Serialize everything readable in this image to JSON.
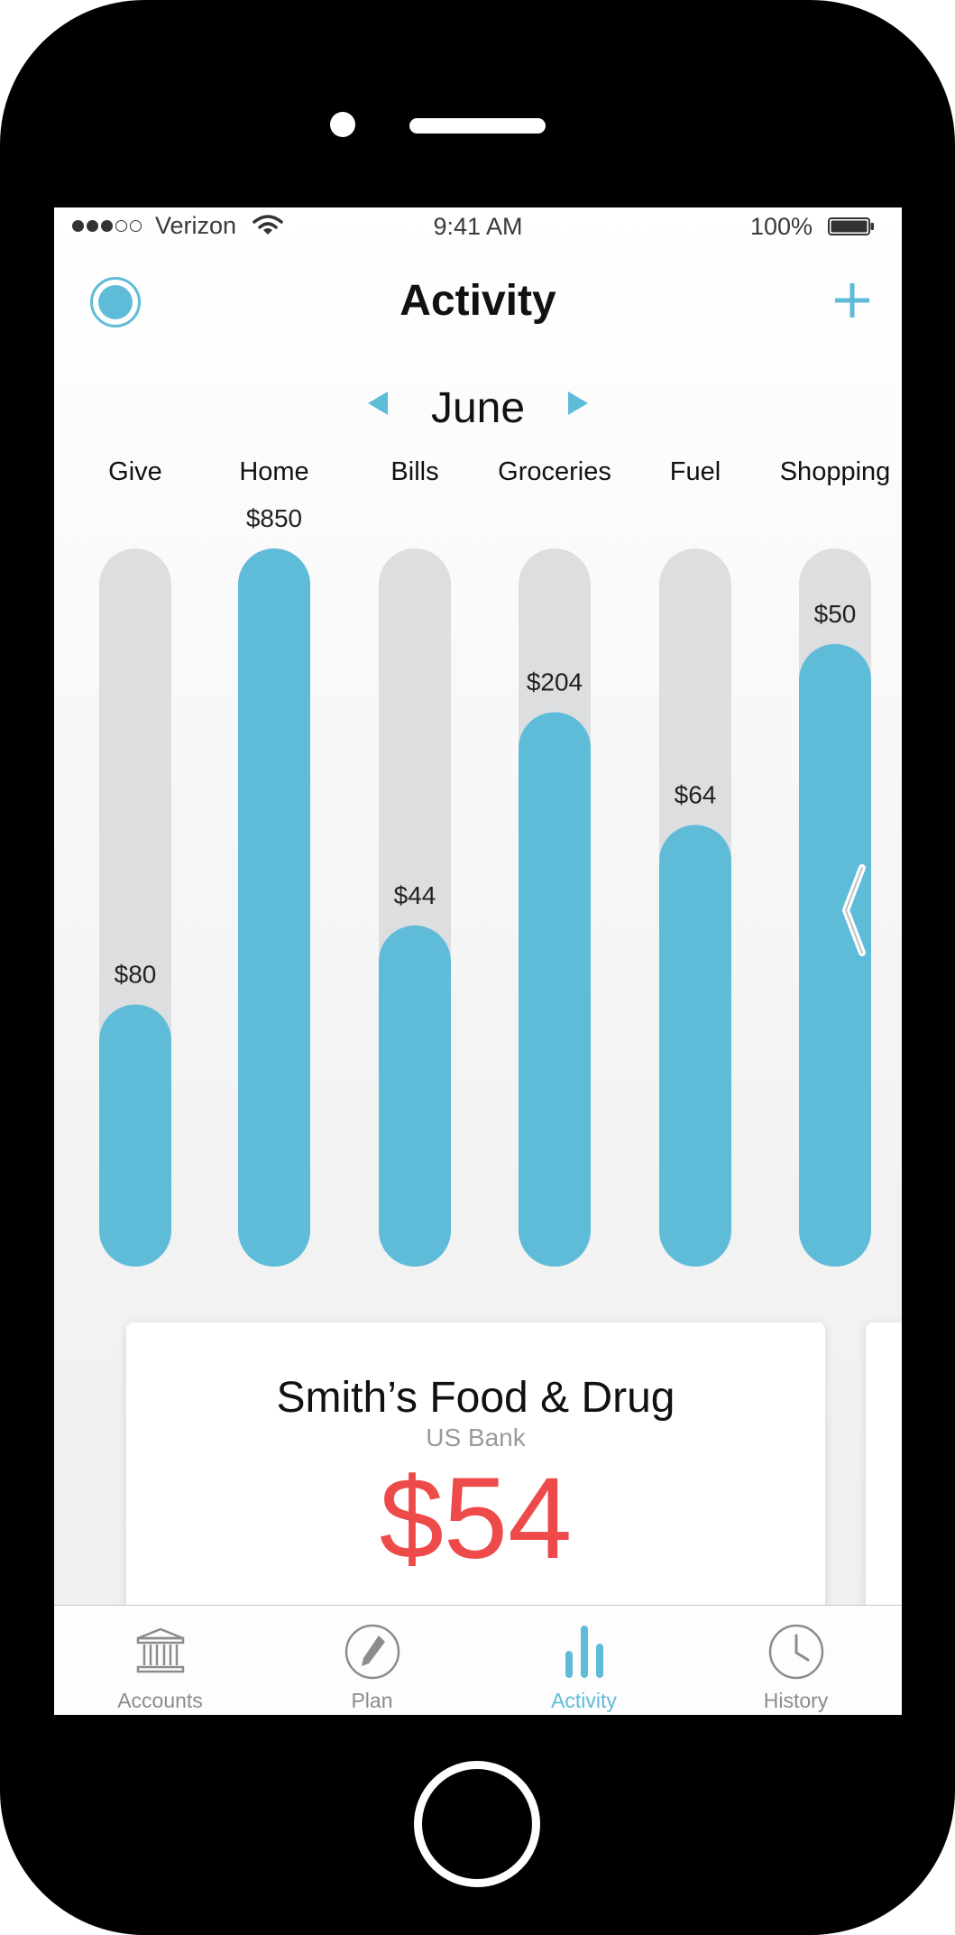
{
  "status_bar": {
    "carrier": "Verizon",
    "time": "9:41 AM",
    "battery": "100%",
    "signal_bars_filled": 3,
    "signal_bars_total": 5
  },
  "header": {
    "title": "Activity",
    "profile_icon": "profile-circle-icon",
    "add_icon": "plus-icon"
  },
  "month_selector": {
    "month": "June",
    "prev_icon": "triangle-left-icon",
    "next_icon": "triangle-right-icon"
  },
  "colors": {
    "accent": "#5fbcd8",
    "track": "#dcdee0",
    "expense": "#ee4a4a"
  },
  "chart_data": {
    "type": "bar",
    "categories": [
      "Give",
      "Home",
      "Bills",
      "Groceries",
      "Fuel",
      "Shopping"
    ],
    "labels": [
      "$80",
      "$850",
      "$44",
      "$204",
      "$64",
      "$50"
    ],
    "fill_fraction": [
      0.365,
      1.0,
      0.475,
      0.772,
      0.615,
      0.867
    ]
  },
  "transaction_card": {
    "merchant": "Smith’s Food & Drug",
    "bank": "US Bank",
    "amount": "$54"
  },
  "tab_bar": {
    "tabs": [
      {
        "label": "Accounts",
        "icon": "bank-icon",
        "active": false
      },
      {
        "label": "Plan",
        "icon": "pencil-icon",
        "active": false
      },
      {
        "label": "Activity",
        "icon": "bar-chart-icon",
        "active": true
      },
      {
        "label": "History",
        "icon": "clock-icon",
        "active": false
      }
    ]
  }
}
